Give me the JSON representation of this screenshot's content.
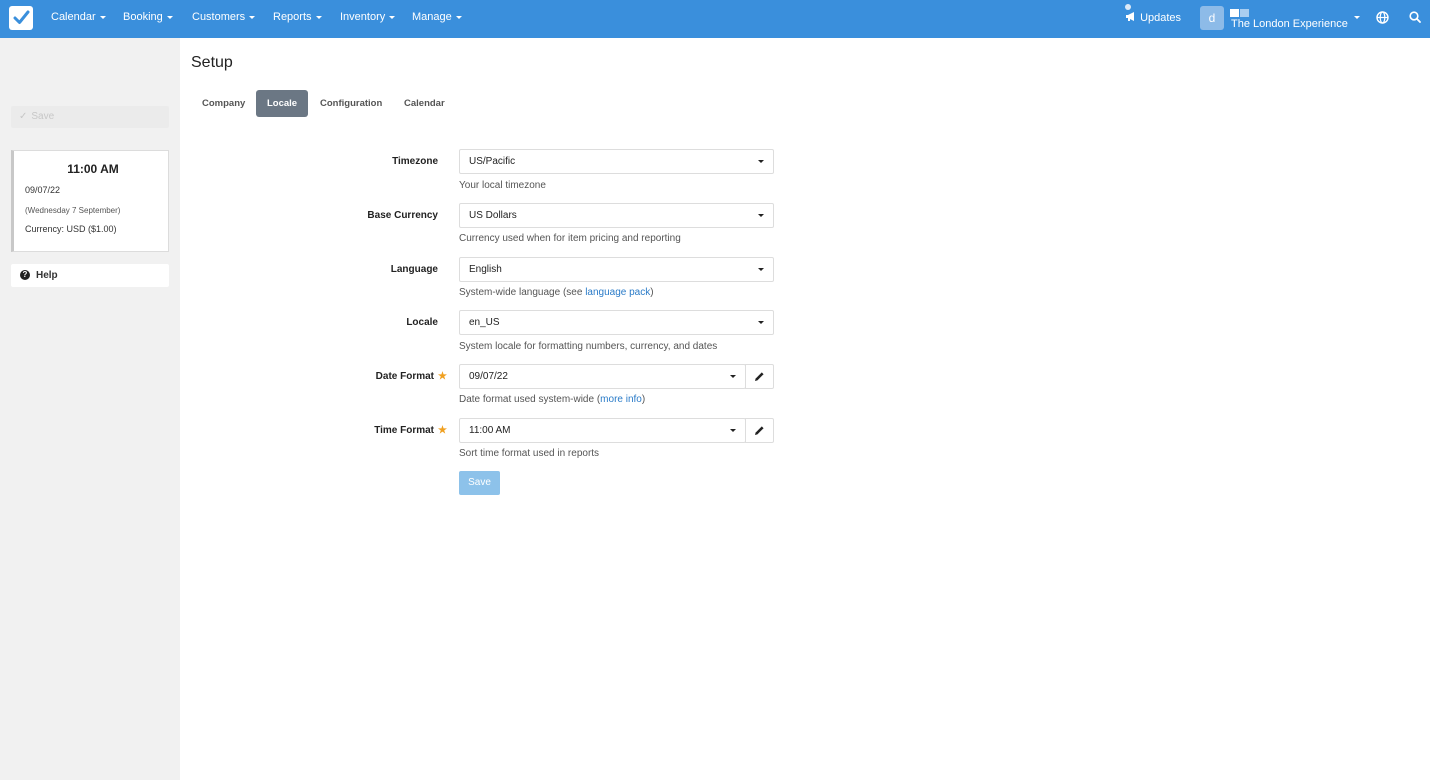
{
  "nav": {
    "items": [
      {
        "label": "Calendar"
      },
      {
        "label": "Booking"
      },
      {
        "label": "Customers"
      },
      {
        "label": "Reports"
      },
      {
        "label": "Inventory"
      },
      {
        "label": "Manage"
      }
    ],
    "updates_label": "Updates",
    "avatar_letter": "d",
    "account_name": "The London Experience",
    "brand_color": "#3a8fdc"
  },
  "sidebar": {
    "save_label": "Save",
    "clock": {
      "time": "11:00 AM",
      "date": "09/07/22",
      "long_date": "(Wednesday 7 September)",
      "currency": "Currency: USD ($1.00)"
    },
    "help_label": "Help"
  },
  "page": {
    "title": "Setup",
    "tabs": [
      {
        "label": "Company",
        "active": false
      },
      {
        "label": "Locale",
        "active": true
      },
      {
        "label": "Configuration",
        "active": false
      },
      {
        "label": "Calendar",
        "active": false
      }
    ]
  },
  "form": {
    "timezone": {
      "label": "Timezone",
      "value": "US/Pacific",
      "help": "Your local timezone"
    },
    "currency": {
      "label": "Base Currency",
      "value": "US Dollars",
      "help": "Currency used when for item pricing and reporting"
    },
    "language": {
      "label": "Language",
      "value": "English",
      "help_prefix": "System-wide language (see ",
      "help_link": "language pack",
      "help_suffix": ")"
    },
    "locale": {
      "label": "Locale",
      "value": "en_US",
      "help": "System locale for formatting numbers, currency, and dates"
    },
    "date_format": {
      "label": "Date Format",
      "value": "09/07/22",
      "help_prefix": "Date format used system-wide (",
      "help_link": "more info",
      "help_suffix": ")"
    },
    "time_format": {
      "label": "Time Format",
      "value": "11:00 AM",
      "help": "Sort time format used in reports"
    },
    "save_label": "Save",
    "required_star": "★"
  }
}
